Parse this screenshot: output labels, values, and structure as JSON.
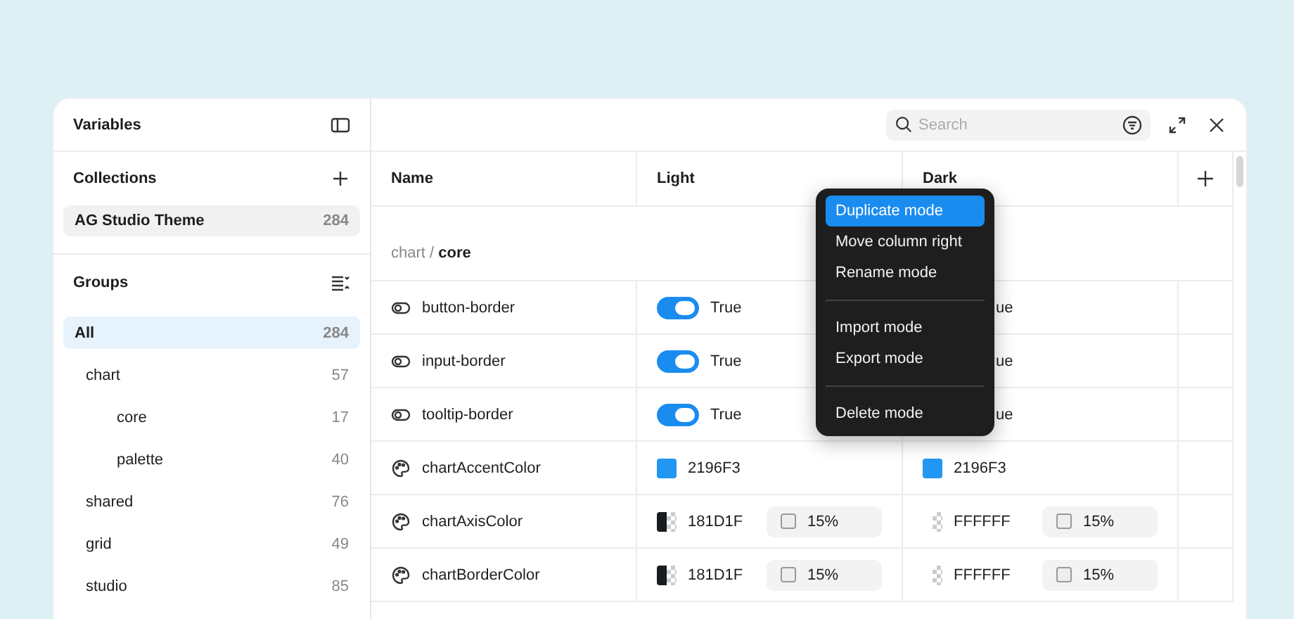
{
  "sidebar": {
    "title": "Variables",
    "collections_label": "Collections",
    "collections": [
      {
        "name": "AG Studio Theme",
        "count": "284",
        "selected": true
      }
    ],
    "groups_label": "Groups",
    "groups": [
      {
        "name": "All",
        "count": "284",
        "selected": true,
        "children": [
          {
            "name": "chart",
            "count": "57",
            "selected": false,
            "children": [
              {
                "name": "core",
                "count": "17",
                "selected": false
              },
              {
                "name": "palette",
                "count": "40",
                "selected": false
              }
            ]
          },
          {
            "name": "shared",
            "count": "76",
            "selected": false
          },
          {
            "name": "grid",
            "count": "49",
            "selected": false
          },
          {
            "name": "studio",
            "count": "85",
            "selected": false
          }
        ]
      }
    ]
  },
  "toolbar": {
    "search": {
      "placeholder": "Search"
    }
  },
  "table": {
    "columns": [
      "Name",
      "Light",
      "Dark"
    ],
    "group_path": {
      "parent": "chart",
      "separator": "/",
      "current": "core"
    },
    "rows": [
      {
        "kind": "boolean",
        "name": "button-border",
        "light": {
          "on": true,
          "text": "True"
        },
        "dark": {
          "text": "ue"
        }
      },
      {
        "kind": "boolean",
        "name": "input-border",
        "light": {
          "on": true,
          "text": "True"
        },
        "dark": {
          "text": "ue"
        }
      },
      {
        "kind": "boolean",
        "name": "tooltip-border",
        "light": {
          "on": true,
          "text": "True"
        },
        "dark": {
          "text": "ue"
        }
      },
      {
        "kind": "color",
        "name": "chartAccentColor",
        "light": {
          "text": "2196F3"
        },
        "dark": {
          "text": "2196F3"
        }
      },
      {
        "kind": "color",
        "name": "chartAxisColor",
        "light": {
          "text": "181D1F",
          "opacity": "15%"
        },
        "dark": {
          "text": "FFFFFF",
          "opacity": "15%"
        }
      },
      {
        "kind": "color",
        "name": "chartBorderColor",
        "light": {
          "text": "181D1F",
          "opacity": "15%"
        },
        "dark": {
          "text": "FFFFFF",
          "opacity": "15%"
        }
      }
    ]
  },
  "context_menu": {
    "sections": [
      [
        {
          "label": "Duplicate mode",
          "selected": true
        },
        {
          "label": "Move column right",
          "selected": false
        },
        {
          "label": "Rename mode",
          "selected": false
        }
      ],
      [
        {
          "label": "Import mode",
          "selected": false
        },
        {
          "label": "Export mode",
          "selected": false
        }
      ],
      [
        {
          "label": "Delete mode",
          "selected": false
        }
      ]
    ]
  }
}
